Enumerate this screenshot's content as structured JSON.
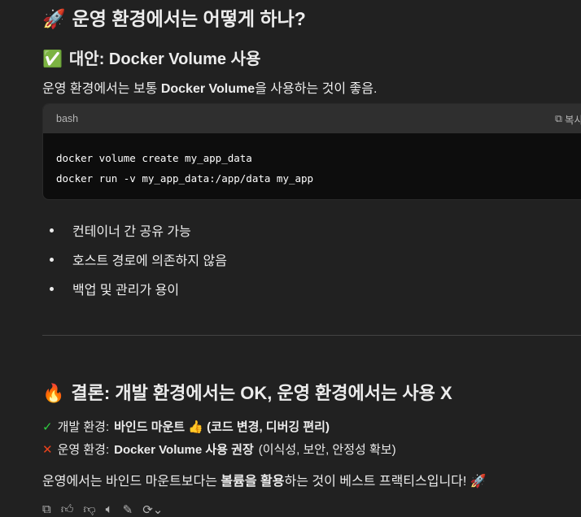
{
  "heading1": {
    "emoji": "🚀",
    "text": "운영 환경에서는 어떻게 하나?"
  },
  "heading2": {
    "emoji": "✅",
    "text": "대안: Docker Volume 사용"
  },
  "intro": {
    "pre": "운영 환경에서는 보통 ",
    "bold": "Docker Volume",
    "post": "을 사용하는 것이 좋음."
  },
  "code": {
    "language": "bash",
    "copy_label": "복사",
    "lines": [
      "docker volume create my_app_data",
      "docker run -v my_app_data:/app/data my_app"
    ]
  },
  "bullets": [
    "컨테이너 간 공유 가능",
    "호스트 경로에 의존하지 않음",
    "백업 및 관리가 용이"
  ],
  "heading3": {
    "emoji": "🔥",
    "text": "결론: 개발 환경에서는 OK, 운영 환경에서는 사용 X"
  },
  "dev_line": {
    "icon": "✓",
    "label": "개발 환경: ",
    "bold": "바인드 마운트 👍 (코드 변경, 디버깅 편리)"
  },
  "prod_line": {
    "icon": "✕",
    "label": "운영 환경: ",
    "bold": "Docker Volume 사용 권장",
    "post": " (이식성, 보안, 안정성 확보)"
  },
  "closing": {
    "pre": "운영에서는 바인드 마운트보다는 ",
    "bold": "볼륨을 활용",
    "post": "하는 것이 베스트 프랙티스입니다! 🚀"
  },
  "colors": {
    "background": "#212121",
    "code_header": "#2f2f2f",
    "code_body": "#0d0d0d",
    "check": "#2ecc40",
    "cross": "#e8421c"
  }
}
